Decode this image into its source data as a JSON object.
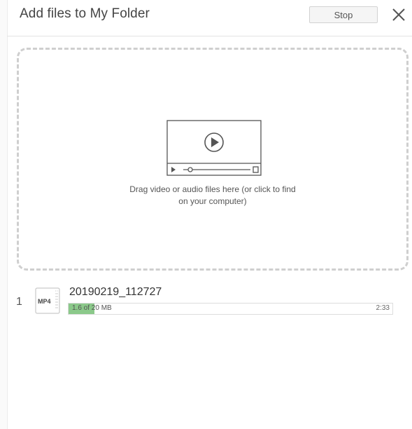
{
  "header": {
    "title": "Add files to My Folder",
    "stop_label": "Stop",
    "close_icon": "close-icon"
  },
  "dropzone": {
    "icon": "video-player-icon",
    "text_line1": "Drag video or audio files here (or click to find",
    "text_line2": "on your computer)"
  },
  "files": [
    {
      "index": "1",
      "type": "MP4",
      "name": "20190219_112727",
      "progress_text": "1.6 of 20 MB",
      "progress_fraction": 0.08,
      "time_remaining": "2:33"
    }
  ],
  "colors": {
    "progress_fill": "#8bc98a",
    "dashed_border": "#cfcfcf"
  }
}
